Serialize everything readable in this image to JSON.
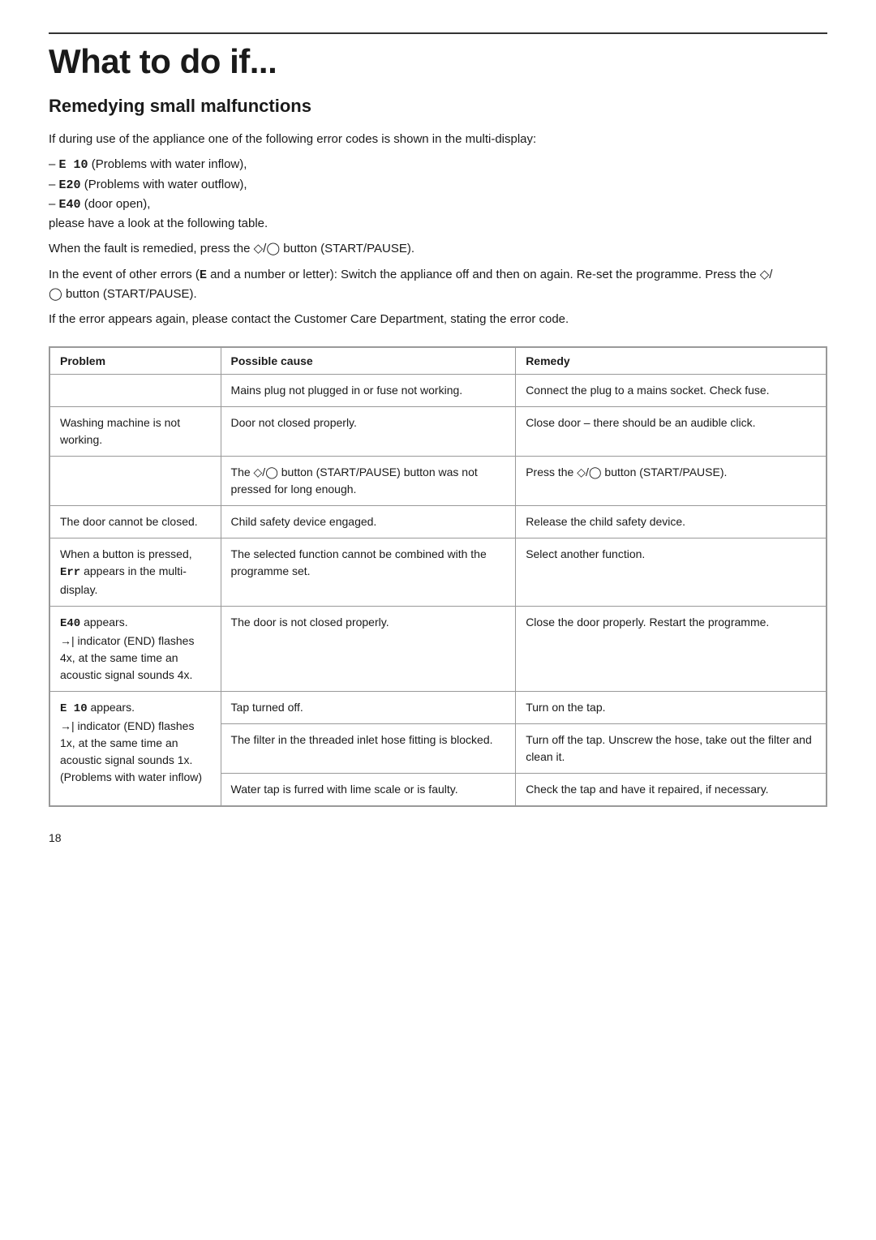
{
  "page": {
    "title": "What to do if...",
    "section_title": "Remedying small malfunctions",
    "page_number": "18",
    "intro_paragraphs": [
      "If during use of the appliance one of the following error codes is shown in the multi-display:",
      "– E 10 (Problems with water inflow),\n– E20 (Problems with water outflow),\n– E40 (door open),\nplease have a look at the following table.",
      "When the fault is remedied, press the ◇/◯ button (START/PAUSE).",
      "In the event of other errors (E and a number or letter): Switch the appliance off and then on again. Re-set the programme. Press the ◇/◯ button (START/PAUSE).",
      "If the error appears again, please contact the Customer Care Department, stating the error code."
    ],
    "table": {
      "headers": [
        "Problem",
        "Possible cause",
        "Remedy"
      ],
      "rows": [
        {
          "problem": "",
          "cause": "Mains plug not plugged in or fuse not working.",
          "remedy": "Connect the plug to a mains socket. Check fuse."
        },
        {
          "problem": "Washing machine is not working.",
          "cause": "Door not closed properly.",
          "remedy": "Close door – there should be an audible click."
        },
        {
          "problem": "",
          "cause": "The ◇/◯ button (START/PAUSE) button was not pressed for long enough.",
          "remedy": "Press the ◇/◯ button (START/PAUSE)."
        },
        {
          "problem": "The door cannot be closed.",
          "cause": "Child safety device engaged.",
          "remedy": "Release the child safety device."
        },
        {
          "problem": "When a button is pressed, Err appears in the multi-display.",
          "cause": "The selected function cannot be combined with the programme set.",
          "remedy": "Select another function."
        },
        {
          "problem": "E40 appears.\n→| indicator (END) flashes 4x, at the same time an acoustic signal sounds 4x.",
          "cause": "The door is not closed properly.",
          "remedy": "Close the door properly. Restart the programme."
        },
        {
          "problem": "E 10 appears.\n→| indicator (END) flashes 1x, at the same time an acoustic signal sounds 1x.\n(Problems with water inflow)",
          "cause": "Tap turned off.",
          "remedy": "Turn on the tap."
        },
        {
          "problem": "",
          "cause": "The filter in the threaded inlet hose fitting is blocked.",
          "remedy": "Turn off the tap. Unscrew the hose, take out the filter and clean it."
        },
        {
          "problem": "",
          "cause": "Water tap is furred with lime scale or is faulty.",
          "remedy": "Check the tap and have it repaired, if necessary."
        }
      ]
    }
  }
}
